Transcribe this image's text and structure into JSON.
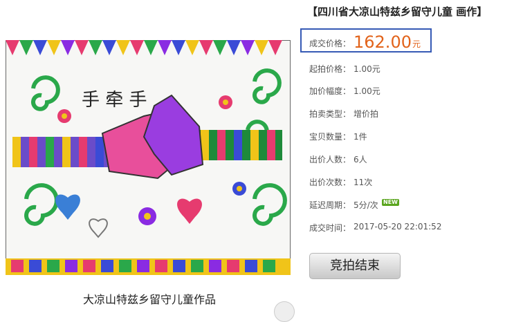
{
  "title": "【四川省大凉山特兹乡留守儿童 画作】",
  "image": {
    "caption": "大凉山特兹乡留守儿童作品",
    "art_text": "手 牵 手"
  },
  "auction": {
    "final_price_label": "成交价格：",
    "final_price_value": "162.00",
    "final_price_unit": "元",
    "start_price_label": "起拍价格：",
    "start_price_value": "1.00元",
    "increment_label": "加价幅度：",
    "increment_value": "1.00元",
    "type_label": "拍卖类型：",
    "type_value": "增价拍",
    "qty_label": "宝贝数量：",
    "qty_value": "1件",
    "bidders_label": "出价人数：",
    "bidders_value": "6人",
    "bids_label": "出价次数：",
    "bids_value": "11次",
    "extend_label": "延迟周期：",
    "extend_value": "5分/次",
    "new_badge": "NEW",
    "time_label": "成交时间：",
    "time_value": "2017-05-20 22:01:52",
    "end_button": "竞拍结束"
  },
  "colors": {
    "price": "#e2631a",
    "box_border": "#3559b5",
    "badge": "#5aa51e"
  }
}
